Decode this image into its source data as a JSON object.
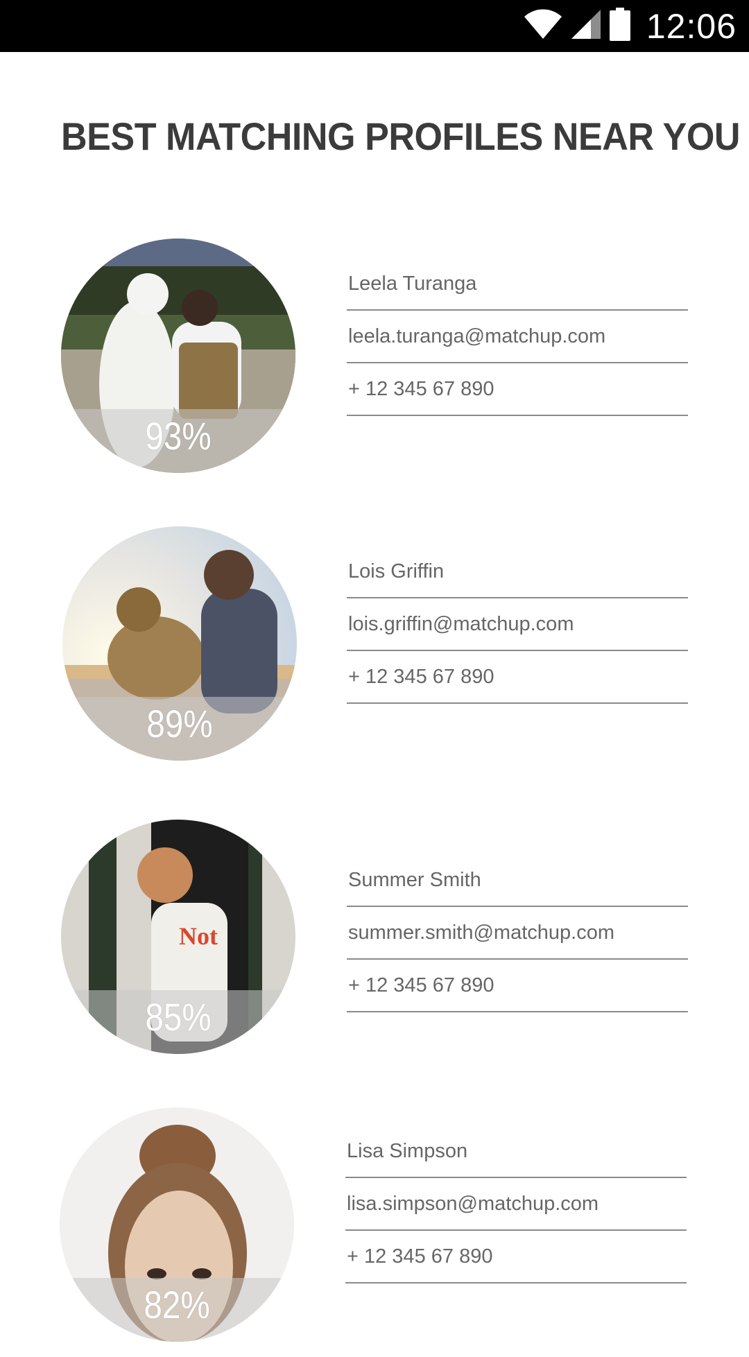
{
  "status_bar": {
    "time": "12:06",
    "icons": [
      "wifi-icon",
      "cell-signal-icon",
      "battery-icon"
    ]
  },
  "page": {
    "title": "BEST MATCHING PROFILES NEAR YOU"
  },
  "profiles": [
    {
      "name": "Leela Turanga",
      "email": "leela.turanga@matchup.com",
      "phone": "+ 12 345 67 890",
      "match": "93%"
    },
    {
      "name": "Lois Griffin",
      "email": "lois.griffin@matchup.com",
      "phone": "+ 12 345 67 890",
      "match": "89%"
    },
    {
      "name": "Summer Smith",
      "email": "summer.smith@matchup.com",
      "phone": "+ 12 345 67 890",
      "match": "85%"
    },
    {
      "name": "Lisa Simpson",
      "email": "lisa.simpson@matchup.com",
      "phone": "+ 12 345 67 890",
      "match": "82%"
    }
  ],
  "colors": {
    "status_bar": "#000000",
    "title_text": "#3b3b3b",
    "field_text": "#666666",
    "divider": "#8a8a8a"
  }
}
